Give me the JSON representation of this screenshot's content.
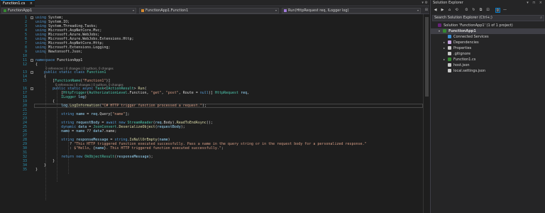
{
  "tab": {
    "label": "Function1.cs",
    "close": "×",
    "right_glyphs": "▾ ⚙"
  },
  "nav": {
    "project": "FunctionApp1",
    "class": "FunctionApp1.Function1",
    "member": "Run(HttpRequest req, ILogger log)"
  },
  "lines": [
    {
      "n": "1",
      "parts": [
        [
          "kw",
          "using"
        ],
        [
          "pl",
          " System;"
        ]
      ]
    },
    {
      "n": "2",
      "parts": [
        [
          "kw",
          "using"
        ],
        [
          "pl",
          " System.IO;"
        ]
      ]
    },
    {
      "n": "3",
      "parts": [
        [
          "kw",
          "using"
        ],
        [
          "pl",
          " System.Threading.Tasks;"
        ]
      ]
    },
    {
      "n": "4",
      "parts": [
        [
          "kw",
          "using"
        ],
        [
          "pl",
          " Microsoft.AspNetCore.Mvc;"
        ]
      ]
    },
    {
      "n": "5",
      "parts": [
        [
          "kw",
          "using"
        ],
        [
          "pl",
          " Microsoft.Azure.WebJobs;"
        ]
      ]
    },
    {
      "n": "6",
      "parts": [
        [
          "kw",
          "using"
        ],
        [
          "pl",
          " Microsoft.Azure.WebJobs.Extensions.Http;"
        ]
      ]
    },
    {
      "n": "7",
      "parts": [
        [
          "kw",
          "using"
        ],
        [
          "pl",
          " Microsoft.AspNetCore.Http;"
        ]
      ]
    },
    {
      "n": "8",
      "parts": [
        [
          "kw",
          "using"
        ],
        [
          "pl",
          " Microsoft.Extensions.Logging;"
        ]
      ]
    },
    {
      "n": "9",
      "parts": [
        [
          "kw",
          "using"
        ],
        [
          "pl",
          " Newtonsoft.Json;"
        ]
      ]
    },
    {
      "n": "10",
      "parts": []
    },
    {
      "n": "11",
      "parts": [
        [
          "kw",
          "namespace"
        ],
        [
          "pl",
          " FunctionApp1"
        ]
      ]
    },
    {
      "n": "12",
      "parts": [
        [
          "pl",
          "{"
        ]
      ]
    },
    {
      "n": "13",
      "lens": "0 references | 0 changes | 0 authors, 0 changes",
      "parts": [
        [
          "pl",
          "    "
        ],
        [
          "kw",
          "public static class"
        ],
        [
          "pl",
          " "
        ],
        [
          "ty",
          "Function1"
        ]
      ]
    },
    {
      "n": "14",
      "parts": [
        [
          "pl",
          "    {"
        ]
      ]
    },
    {
      "n": "15",
      "parts": [
        [
          "pl",
          "        ["
        ],
        [
          "ty",
          "FunctionName"
        ],
        [
          "pl",
          "("
        ],
        [
          "st",
          "\"Function1\""
        ],
        [
          "pl",
          ")]"
        ]
      ]
    },
    {
      "n": "16",
      "lens": "0 references | 0 changes | 0 authors, 0 changes",
      "parts": [
        [
          "pl",
          "        "
        ],
        [
          "kw",
          "public static async"
        ],
        [
          "pl",
          " "
        ],
        [
          "ty",
          "Task"
        ],
        [
          "pl",
          "<"
        ],
        [
          "ty",
          "IActionResult"
        ],
        [
          "pl",
          "> "
        ],
        [
          "fn",
          "Run"
        ],
        [
          "pl",
          "("
        ]
      ]
    },
    {
      "n": "17",
      "parts": [
        [
          "pl",
          "            ["
        ],
        [
          "ty",
          "HttpTrigger"
        ],
        [
          "pl",
          "("
        ],
        [
          "ty",
          "AuthorizationLevel"
        ],
        [
          "pl",
          ".Function, "
        ],
        [
          "st",
          "\"get\""
        ],
        [
          "pl",
          ", "
        ],
        [
          "st",
          "\"post\""
        ],
        [
          "pl",
          ", Route = "
        ],
        [
          "kw",
          "null"
        ],
        [
          "pl",
          ")] "
        ],
        [
          "ty",
          "HttpRequest"
        ],
        [
          "pl",
          " "
        ],
        [
          "pa",
          "req"
        ],
        [
          "pl",
          ","
        ]
      ]
    },
    {
      "n": "18",
      "parts": [
        [
          "pl",
          "            "
        ],
        [
          "ty",
          "ILogger"
        ],
        [
          "pl",
          " "
        ],
        [
          "pa",
          "log"
        ],
        [
          "pl",
          ")"
        ]
      ]
    },
    {
      "n": "19",
      "parts": [
        [
          "pl",
          "        {"
        ]
      ]
    },
    {
      "n": "20",
      "parts": [
        [
          "pl",
          "            "
        ],
        [
          "pa",
          "log"
        ],
        [
          "pl",
          "."
        ],
        [
          "fn",
          "LogInformation"
        ],
        [
          "pl",
          "("
        ],
        [
          "st",
          "\"C# HTTP trigger function processed a request.\""
        ],
        [
          "pl",
          ");"
        ]
      ]
    },
    {
      "n": "21",
      "parts": []
    },
    {
      "n": "22",
      "parts": [
        [
          "pl",
          "            "
        ],
        [
          "kw",
          "string"
        ],
        [
          "pl",
          " "
        ],
        [
          "pa",
          "name"
        ],
        [
          "pl",
          " = "
        ],
        [
          "pa",
          "req"
        ],
        [
          "pl",
          ".Query["
        ],
        [
          "st",
          "\"name\""
        ],
        [
          "pl",
          "];"
        ]
      ]
    },
    {
      "n": "23",
      "parts": []
    },
    {
      "n": "24",
      "parts": [
        [
          "pl",
          "            "
        ],
        [
          "kw",
          "string"
        ],
        [
          "pl",
          " "
        ],
        [
          "pa",
          "requestBody"
        ],
        [
          "pl",
          " = "
        ],
        [
          "kw",
          "await new"
        ],
        [
          "pl",
          " "
        ],
        [
          "ty",
          "StreamReader"
        ],
        [
          "pl",
          "("
        ],
        [
          "pa",
          "req"
        ],
        [
          "pl",
          ".Body)."
        ],
        [
          "fn",
          "ReadToEndAsync"
        ],
        [
          "pl",
          "();"
        ]
      ]
    },
    {
      "n": "25",
      "parts": [
        [
          "pl",
          "            "
        ],
        [
          "kw",
          "dynamic"
        ],
        [
          "pl",
          " "
        ],
        [
          "pa",
          "data"
        ],
        [
          "pl",
          " = "
        ],
        [
          "ty",
          "JsonConvert"
        ],
        [
          "pl",
          "."
        ],
        [
          "fn",
          "DeserializeObject"
        ],
        [
          "pl",
          "("
        ],
        [
          "pa",
          "requestBody"
        ],
        [
          "pl",
          ");"
        ]
      ]
    },
    {
      "n": "26",
      "parts": [
        [
          "pl",
          "            "
        ],
        [
          "pa",
          "name"
        ],
        [
          "pl",
          " = "
        ],
        [
          "pa",
          "name"
        ],
        [
          "pl",
          " ?? "
        ],
        [
          "pa",
          "data"
        ],
        [
          "pl",
          "?.name;"
        ]
      ]
    },
    {
      "n": "27",
      "parts": []
    },
    {
      "n": "28",
      "parts": [
        [
          "pl",
          "            "
        ],
        [
          "kw",
          "string"
        ],
        [
          "pl",
          " "
        ],
        [
          "pa",
          "responseMessage"
        ],
        [
          "pl",
          " = "
        ],
        [
          "kw",
          "string"
        ],
        [
          "pl",
          "."
        ],
        [
          "fn",
          "IsNullOrEmpty"
        ],
        [
          "pl",
          "("
        ],
        [
          "pa",
          "name"
        ],
        [
          "pl",
          ")"
        ]
      ]
    },
    {
      "n": "29",
      "parts": [
        [
          "pl",
          "                ? "
        ],
        [
          "st",
          "\"This HTTP triggered function executed successfully. Pass a name in the query string or in the request body for a personalized response.\""
        ]
      ]
    },
    {
      "n": "30",
      "parts": [
        [
          "pl",
          "                : "
        ],
        [
          "st",
          "$\"Hello, "
        ],
        [
          "pl",
          "{"
        ],
        [
          "pa",
          "name"
        ],
        [
          "pl",
          "}"
        ],
        [
          "st",
          ". This HTTP triggered function executed successfully.\""
        ],
        [
          "pl",
          ";"
        ]
      ]
    },
    {
      "n": "31",
      "parts": []
    },
    {
      "n": "32",
      "parts": [
        [
          "pl",
          "            "
        ],
        [
          "kw",
          "return new"
        ],
        [
          "pl",
          " "
        ],
        [
          "ty",
          "OkObjectResult"
        ],
        [
          "pl",
          "("
        ],
        [
          "pa",
          "responseMessage"
        ],
        [
          "pl",
          ");"
        ]
      ]
    },
    {
      "n": "33",
      "parts": [
        [
          "pl",
          "        }"
        ]
      ]
    },
    {
      "n": "34",
      "parts": [
        [
          "pl",
          "    }"
        ]
      ]
    },
    {
      "n": "35",
      "parts": [
        [
          "pl",
          "}"
        ]
      ]
    }
  ],
  "solution_explorer": {
    "title": "Solution Explorer",
    "title_buttons": "▾ ⊓ ×",
    "search_placeholder": "Search Solution Explorer (Ctrl+;)",
    "search_icon": "⌕",
    "toolbar_glyphs": [
      "◀",
      "▶",
      "⌂",
      "⟲",
      "⏲",
      "↻",
      "⧉",
      "⊡",
      "⚲",
      "—"
    ],
    "items": [
      {
        "label": "Solution 'FunctionApp1' (1 of 1 project)",
        "icon": "solution-icon",
        "icon_color": "#68217a",
        "indent": 0,
        "arrow": ""
      },
      {
        "label": "FunctionApp1",
        "icon": "csharp-project-icon",
        "icon_color": "#368832",
        "indent": 1,
        "arrow": "▾",
        "selected": true,
        "bold": true
      },
      {
        "label": "Connected Services",
        "icon": "connected-services-icon",
        "icon_color": "#3c8fd7",
        "indent": 2,
        "arrow": ""
      },
      {
        "label": "Dependencies",
        "icon": "dependencies-icon",
        "icon_color": "#c5a3e0",
        "indent": 2,
        "arrow": "▸"
      },
      {
        "label": "Properties",
        "icon": "wrench-icon",
        "icon_color": "#c8c8c8",
        "indent": 2,
        "arrow": "▸"
      },
      {
        "label": ".gitignore",
        "icon": "file-icon",
        "icon_color": "#c8c8c8",
        "indent": 2,
        "arrow": ""
      },
      {
        "label": "Function1.cs",
        "icon": "csharp-file-icon",
        "icon_color": "#368832",
        "indent": 2,
        "arrow": "▸"
      },
      {
        "label": "host.json",
        "icon": "json-file-icon",
        "icon_color": "#c8c8c8",
        "indent": 2,
        "arrow": ""
      },
      {
        "label": "local.settings.json",
        "icon": "json-file-icon",
        "icon_color": "#c8c8c8",
        "indent": 2,
        "arrow": ""
      }
    ]
  }
}
